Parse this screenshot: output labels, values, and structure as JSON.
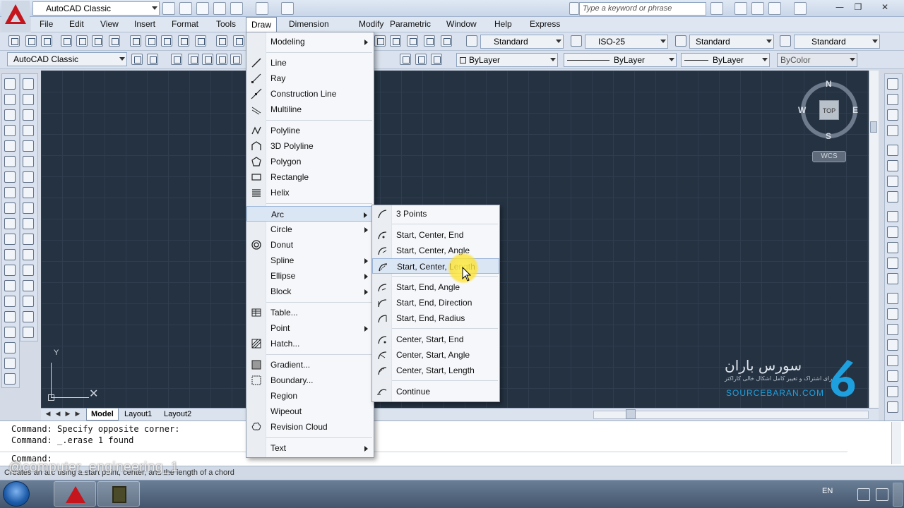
{
  "titlebar": {
    "workspace": "AutoCAD Classic",
    "search_placeholder": "Type a keyword or phrase",
    "minimize": "—",
    "restore": "❐",
    "close": "✕"
  },
  "menubar": {
    "items": [
      "File",
      "Edit",
      "View",
      "Insert",
      "Format",
      "Tools",
      "Draw",
      "Dimension",
      "Modify",
      "Parametric",
      "Window",
      "Help",
      "Express"
    ]
  },
  "toolbar": {
    "workspace_select": "AutoCAD Classic",
    "text_style": "Standard",
    "dim_style": "ISO-25",
    "table_style": "Standard",
    "multileader_style": "Standard",
    "color": "ByLayer",
    "linetype": "ByLayer",
    "lineweight": "ByLayer",
    "plot_style": "ByColor"
  },
  "draw_menu": {
    "items": [
      {
        "label": "Modeling",
        "submenu": true
      },
      {
        "label": "Line"
      },
      {
        "label": "Ray"
      },
      {
        "label": "Construction Line"
      },
      {
        "label": "Multiline"
      },
      {
        "label": "Polyline"
      },
      {
        "label": "3D Polyline"
      },
      {
        "label": "Polygon"
      },
      {
        "label": "Rectangle"
      },
      {
        "label": "Helix"
      },
      {
        "label": "Arc",
        "submenu": true
      },
      {
        "label": "Circle",
        "submenu": true
      },
      {
        "label": "Donut"
      },
      {
        "label": "Spline",
        "submenu": true
      },
      {
        "label": "Ellipse",
        "submenu": true
      },
      {
        "label": "Block",
        "submenu": true
      },
      {
        "label": "Table..."
      },
      {
        "label": "Point",
        "submenu": true
      },
      {
        "label": "Hatch..."
      },
      {
        "label": "Gradient..."
      },
      {
        "label": "Boundary..."
      },
      {
        "label": "Region"
      },
      {
        "label": "Wipeout"
      },
      {
        "label": "Revision Cloud"
      },
      {
        "label": "Text",
        "submenu": true
      }
    ]
  },
  "arc_menu": {
    "items": [
      "3 Points",
      "Start, Center, End",
      "Start, Center, Angle",
      "Start, Center, Length",
      "Start, End, Angle",
      "Start, End, Direction",
      "Start, End, Radius",
      "Center, Start, End",
      "Center, Start, Angle",
      "Center, Start, Length",
      "Continue"
    ],
    "highlighted": "Start, Center, Length"
  },
  "viewcube": {
    "north": "N",
    "south": "S",
    "east": "E",
    "west": "W",
    "face": "TOP",
    "ucs": "WCS"
  },
  "ucs_icon": {
    "y": "Y"
  },
  "layout_tabs": [
    "Model",
    "Layout1",
    "Layout2"
  ],
  "command_line": {
    "history": [
      "Command: Specify opposite corner:",
      "Command: _.erase 1 found"
    ],
    "prompt": "Command:"
  },
  "status_hint": "Creates an arc using a start point, center, and the length of a chord",
  "watermark": "@computer_engineering_1",
  "brand": {
    "name_fa": "سورس باران",
    "tagline_fa": "برای اشتراک و تغییر کامل اشکال خالی کاراکتر",
    "name_en": "SOURCEBARAN.COM",
    "color": "#1ea0de"
  },
  "taskbar": {
    "language": "EN"
  },
  "colors": {
    "canvas": "#253242",
    "menu_hover": "#dbe6f5",
    "cursor_highlight": "#ffe628"
  }
}
